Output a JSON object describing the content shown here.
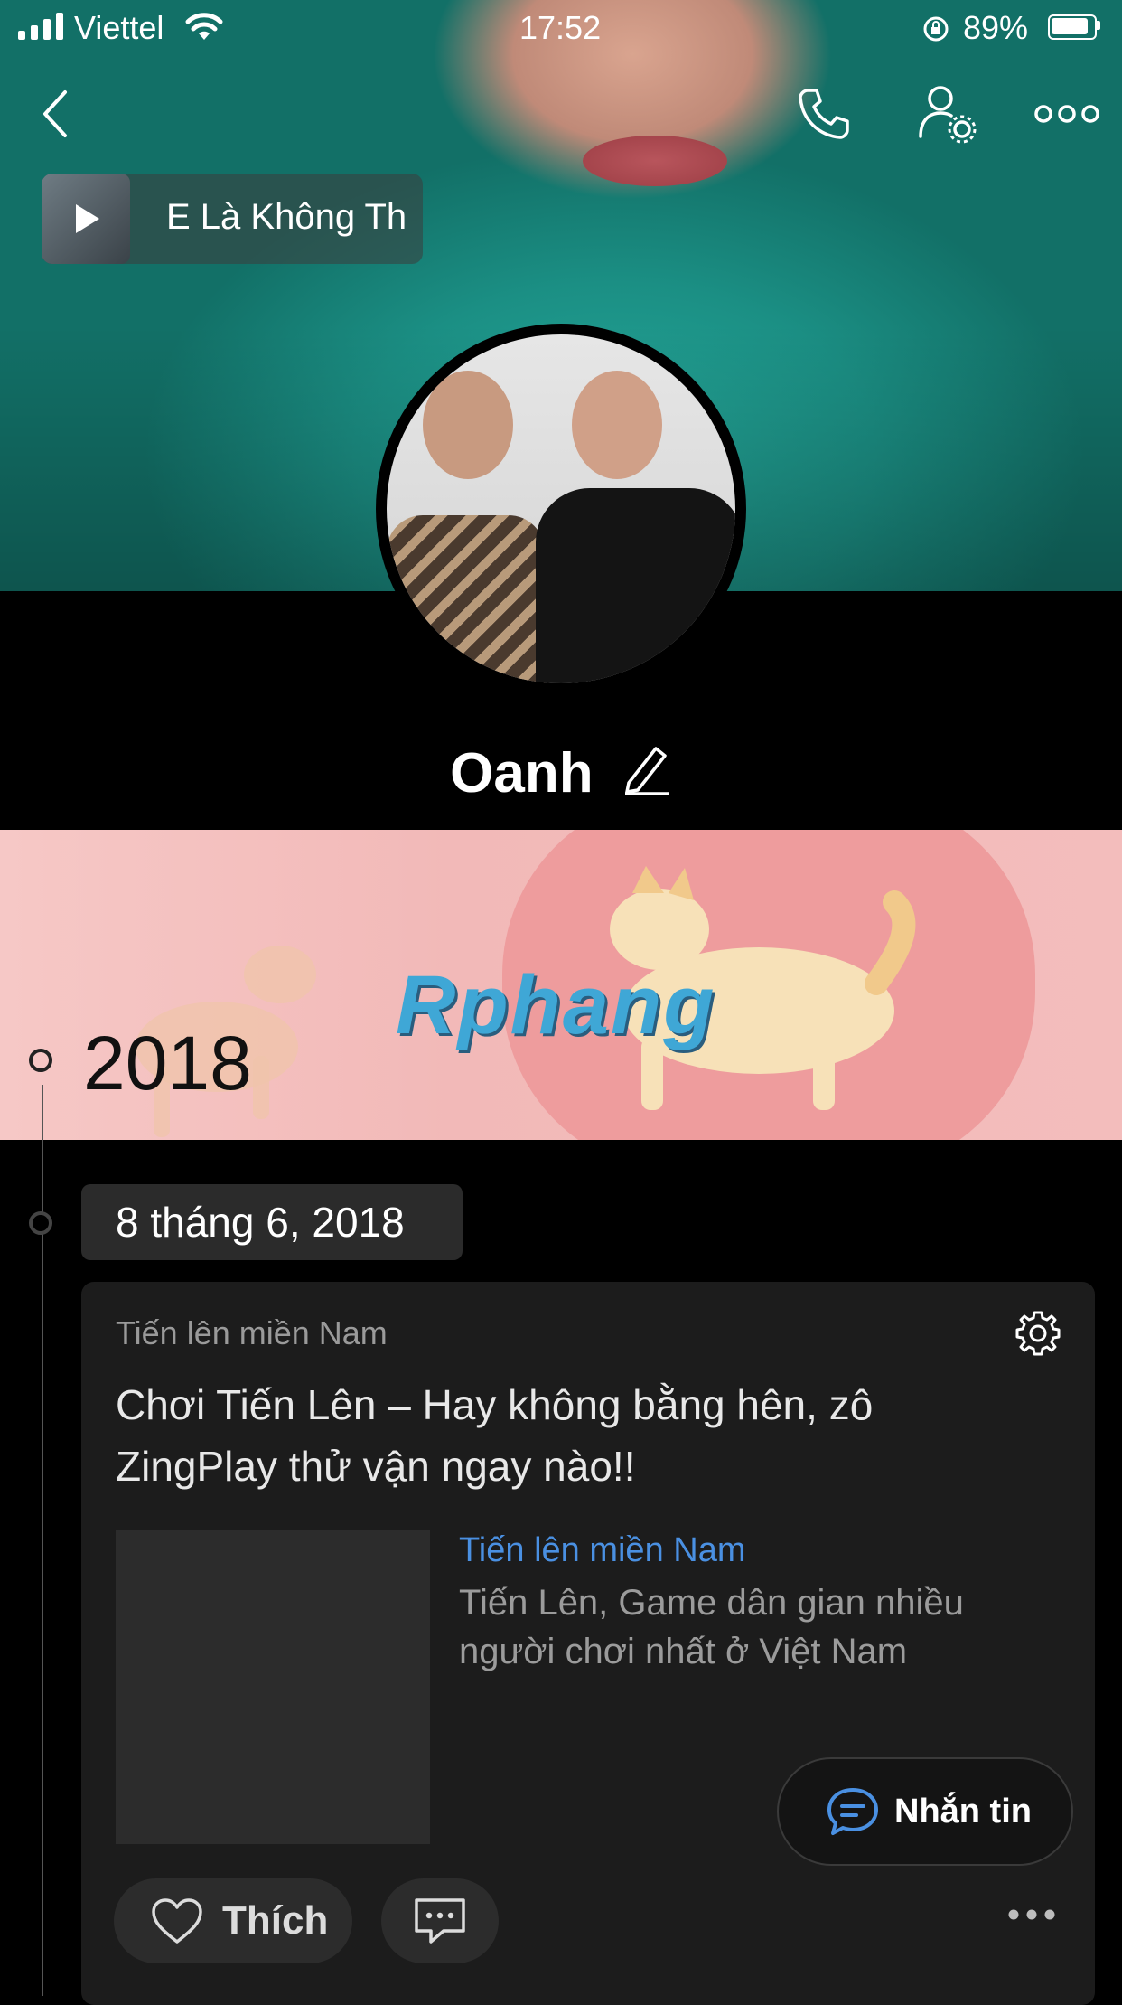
{
  "status_bar": {
    "carrier": "Viettel",
    "time": "17:52",
    "battery": "89%"
  },
  "profile": {
    "name": "Oanh",
    "now_playing": "E Là Không Th"
  },
  "timeline": {
    "year": "2018",
    "date": "8 tháng 6, 2018"
  },
  "post": {
    "source": "Tiến lên miền Nam",
    "text": "Chơi Tiến Lên – Hay không bằng hên, zô ZingPlay thử vận ngay nào!!",
    "link": {
      "title": "Tiến lên miền Nam",
      "description": "Tiến Lên, Game dân gian nhiều người chơi nhất ở Việt Nam"
    },
    "like_label": "Thích"
  },
  "message_button": {
    "label": "Nhắn tin"
  },
  "watermark": "Rphang",
  "colors": {
    "accent": "#4a90e2",
    "card_bg": "#1c1c1c",
    "banner_pink": "#f2b9b8"
  }
}
